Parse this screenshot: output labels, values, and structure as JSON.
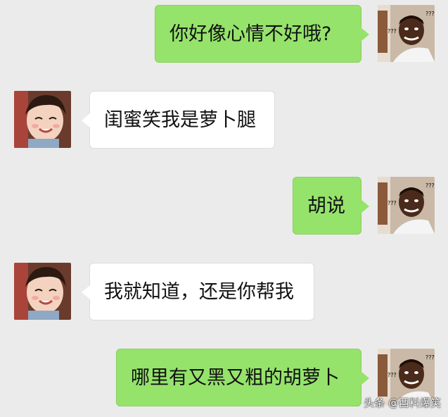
{
  "messages": [
    {
      "side": "right",
      "text": "你好像心情不好哦?",
      "avatar_text": "???"
    },
    {
      "side": "left",
      "text": "闺蜜笑我是萝卜腿"
    },
    {
      "side": "right",
      "text": "胡说",
      "avatar_text": "???"
    },
    {
      "side": "left",
      "text": "我就知道，还是你帮我"
    },
    {
      "side": "right",
      "text": "哪里有又黑又粗的胡萝卜",
      "avatar_text": "???"
    }
  ],
  "watermark": "头条 @酉料爆笑",
  "colors": {
    "background": "#ebebeb",
    "sent_bubble": "#95e36b",
    "received_bubble": "#ffffff"
  },
  "icons": {
    "sender_avatar": "confused-man-avatar-icon",
    "receiver_avatar": "smiling-child-avatar-icon"
  }
}
